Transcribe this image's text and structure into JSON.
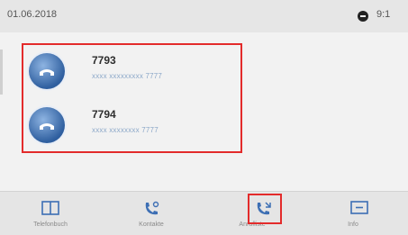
{
  "status_bar": {
    "date": "01.06.2018",
    "time": "9:1"
  },
  "entries": [
    {
      "number": "7793",
      "detail": "xxxx xxxxxxxxx 7777",
      "icon": "phone-handset-icon"
    },
    {
      "number": "7794",
      "detail": "xxxx xxxxxxxx 7777",
      "icon": "phone-handset-icon"
    }
  ],
  "nav": [
    {
      "label": "Telefonbuch",
      "icon": "book-icon"
    },
    {
      "label": "Kontakte",
      "icon": "phone-contact-icon"
    },
    {
      "label": "Anrufliste",
      "icon": "call-log-icon",
      "active": true
    },
    {
      "label": "Info",
      "icon": "info-screen-icon"
    }
  ],
  "colors": {
    "accent": "#3d6fb4",
    "highlight": "#e32b2b",
    "avatar": "#2f5f9f"
  }
}
